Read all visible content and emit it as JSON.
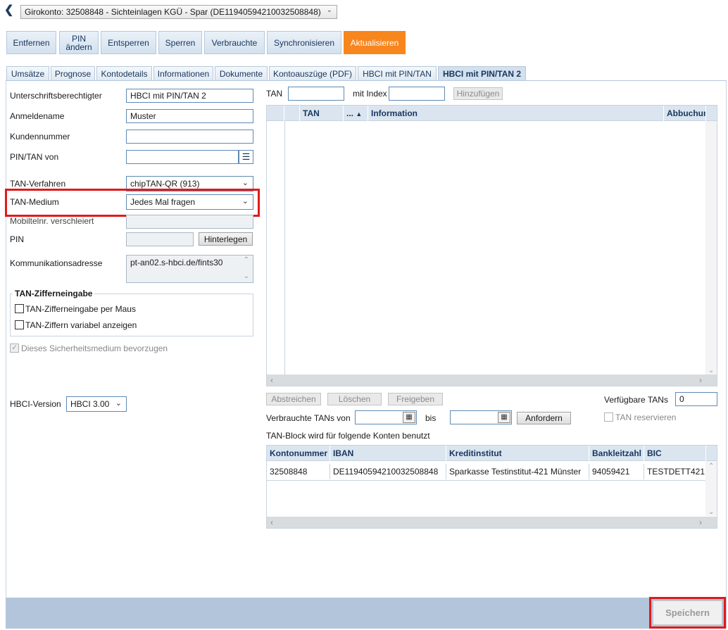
{
  "account": {
    "selected": "Girokonto: 32508848 - Sichteinlagen KGÜ - Spar (DE11940594210032508848)"
  },
  "toolbar": {
    "entfernen": "Entfernen",
    "pin_aendern_1": "PIN",
    "pin_aendern_2": "ändern",
    "entsperren": "Entsperren",
    "sperren": "Sperren",
    "verbrauchte": "Verbrauchte",
    "synchronisieren": "Synchronisieren",
    "aktualisieren": "Aktualisieren"
  },
  "tabs": [
    "Umsätze",
    "Prognose",
    "Kontodetails",
    "Informationen",
    "Dokumente",
    "Kontoauszüge (PDF)",
    "HBCI mit PIN/TAN",
    "HBCI mit PIN/TAN 2"
  ],
  "active_tab": "HBCI mit PIN/TAN 2",
  "form": {
    "unterschrift_label": "Unterschriftsberechtigter",
    "unterschrift_value": "HBCI mit PIN/TAN 2",
    "anmeldename_label": "Anmeldename",
    "anmeldename_value": "Muster",
    "kundennummer_label": "Kundennummer",
    "kundennummer_value": "",
    "pintan_von_label": "PIN/TAN von",
    "pintan_von_value": "",
    "tan_verfahren_label": "TAN-Verfahren",
    "tan_verfahren_value": "chipTAN-QR (913)",
    "tan_medium_label": "TAN-Medium",
    "tan_medium_value": "Jedes Mal fragen",
    "mobilnr_label": "Mobiltelnr. verschleiert",
    "pin_label": "PIN",
    "hinterlegen": "Hinterlegen",
    "komm_label": "Kommunikationsadresse",
    "komm_value": "pt-an02.s-hbci.de/fints30",
    "group_title": "TAN-Zifferneingabe",
    "chk_maus": "TAN-Zifferneingabe per Maus",
    "chk_variabel": "TAN-Ziffern variabel anzeigen",
    "chk_bevorzugen": "Dieses Sicherheitsmedium bevorzugen",
    "hbci_version_label": "HBCI-Version",
    "hbci_version_value": "HBCI 3.00"
  },
  "tan_panel": {
    "tan_label": "TAN",
    "mit_index_label": "mit Index",
    "hinzufuegen": "Hinzufügen",
    "columns": [
      "TAN",
      "...",
      "Information",
      "Abbuchun"
    ],
    "abstreichen": "Abstreichen",
    "loeschen": "Löschen",
    "freigeben": "Freigeben",
    "verfuegbare_label": "Verfügbare TANs",
    "verfuegbare_value": "0",
    "verbrauchte_von_label": "Verbrauchte TANs von",
    "bis_label": "bis",
    "anfordern": "Anfordern",
    "tan_reservieren": "TAN reservieren",
    "block_caption": "TAN-Block wird für folgende Konten benutzt"
  },
  "accounts_table": {
    "columns": [
      "Kontonummer",
      "IBAN",
      "Kreditinstitut",
      "Bankleitzahl",
      "BIC"
    ],
    "rows": [
      [
        "32508848",
        "DE11940594210032508848",
        "Sparkasse Testinstitut-421 Münster",
        "94059421",
        "TESTDETT421"
      ]
    ]
  },
  "footer": {
    "speichern": "Speichern"
  },
  "colors": {
    "accent": "#f7861d",
    "highlight_red": "#e01b1b",
    "tab_blue": "#d3e1ee"
  },
  "icons": [
    "chevron-left-icon",
    "chevron-down-icon",
    "list-icon",
    "calendar-icon",
    "sort-asc-icon"
  ]
}
